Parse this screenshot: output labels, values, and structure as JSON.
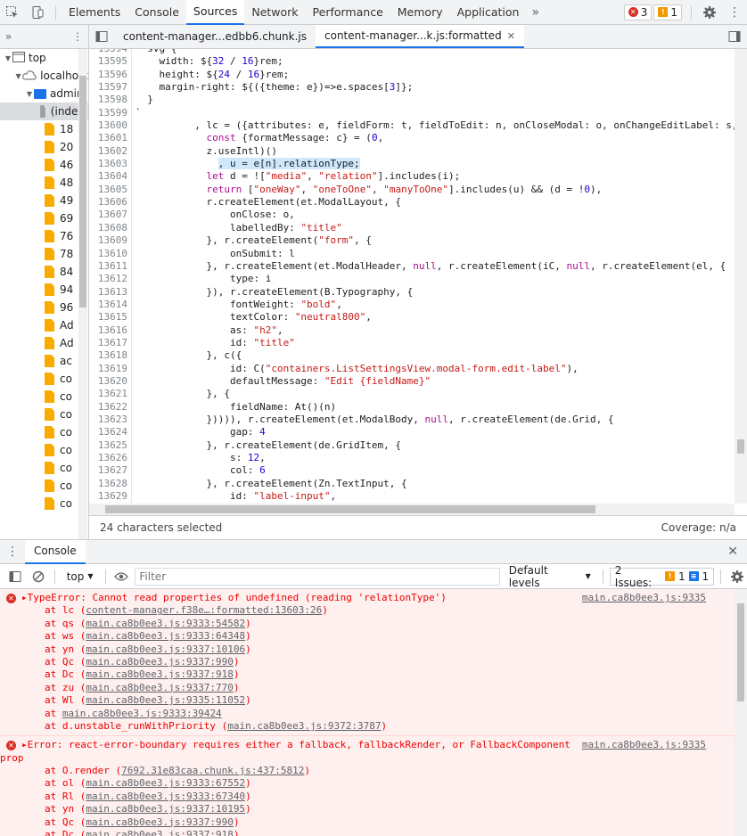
{
  "toolbar": {
    "tabs": [
      "Elements",
      "Console",
      "Sources",
      "Network",
      "Performance",
      "Memory",
      "Application"
    ],
    "active_tab": "Sources",
    "more_label": "»",
    "error_count": "3",
    "warning_count": "1"
  },
  "navigator": {
    "more_label": "»",
    "tree": [
      {
        "label": "top",
        "indent": 0,
        "type": "frame",
        "expanded": true
      },
      {
        "label": "localhost",
        "indent": 1,
        "type": "cloud",
        "expanded": true
      },
      {
        "label": "admin",
        "indent": 2,
        "type": "folder",
        "expanded": true
      },
      {
        "label": "(index)",
        "indent": 3,
        "type": "file-grey",
        "selected": true
      },
      {
        "label": "18",
        "indent": 3,
        "type": "file"
      },
      {
        "label": "20",
        "indent": 3,
        "type": "file"
      },
      {
        "label": "46",
        "indent": 3,
        "type": "file"
      },
      {
        "label": "48",
        "indent": 3,
        "type": "file"
      },
      {
        "label": "49",
        "indent": 3,
        "type": "file"
      },
      {
        "label": "69",
        "indent": 3,
        "type": "file"
      },
      {
        "label": "76",
        "indent": 3,
        "type": "file"
      },
      {
        "label": "78",
        "indent": 3,
        "type": "file"
      },
      {
        "label": "84",
        "indent": 3,
        "type": "file"
      },
      {
        "label": "94",
        "indent": 3,
        "type": "file"
      },
      {
        "label": "96",
        "indent": 3,
        "type": "file"
      },
      {
        "label": "Ad",
        "indent": 3,
        "type": "file"
      },
      {
        "label": "Ad",
        "indent": 3,
        "type": "file"
      },
      {
        "label": "ac",
        "indent": 3,
        "type": "file"
      },
      {
        "label": "co",
        "indent": 3,
        "type": "file"
      },
      {
        "label": "co",
        "indent": 3,
        "type": "file"
      },
      {
        "label": "co",
        "indent": 3,
        "type": "file"
      },
      {
        "label": "co",
        "indent": 3,
        "type": "file"
      },
      {
        "label": "co",
        "indent": 3,
        "type": "file"
      },
      {
        "label": "co",
        "indent": 3,
        "type": "file"
      },
      {
        "label": "co",
        "indent": 3,
        "type": "file"
      },
      {
        "label": "co",
        "indent": 3,
        "type": "file"
      }
    ]
  },
  "editor_tabs": [
    {
      "label": "content-manager...edbb6.chunk.js",
      "active": false
    },
    {
      "label": "content-manager...k.js:formatted",
      "active": true
    }
  ],
  "code": {
    "lines": [
      {
        "n": "13594",
        "html": "  svg {"
      },
      {
        "n": "13595",
        "html": "    width: ${<span class=\"nu\">32</span> / <span class=\"nu\">16</span>}rem;"
      },
      {
        "n": "13596",
        "html": "    height: ${<span class=\"nu\">24</span> / <span class=\"nu\">16</span>}rem;"
      },
      {
        "n": "13597",
        "html": "    margin-right: ${({theme: e})=>e.spaces[<span class=\"nu\">3</span>]};"
      },
      {
        "n": "13598",
        "html": "  }"
      },
      {
        "n": "13599",
        "html": "`"
      },
      {
        "n": "13600",
        "html": "          , lc = ({attributes: e, fieldForm: t, fieldToEdit: n, onCloseModal: o, onChangeEditLabel: s, onSubm"
      },
      {
        "n": "13601",
        "html": "            <span class=\"kw\">const</span> {formatMessage: c} = (<span class=\"nu\">0</span>,"
      },
      {
        "n": "13602",
        "html": "            z.useIntl)()"
      },
      {
        "n": "13603",
        "html": "              <span class=\"hl\">, u = e[n].relationType;</span>"
      },
      {
        "n": "13604",
        "html": "            <span class=\"kw\">let</span> d = ![<span class=\"st\">\"media\"</span>, <span class=\"st\">\"relation\"</span>].includes(i);"
      },
      {
        "n": "13605",
        "html": "            <span class=\"kw\">return</span> [<span class=\"st\">\"oneWay\"</span>, <span class=\"st\">\"oneToOne\"</span>, <span class=\"st\">\"manyToOne\"</span>].includes(u) &amp;&amp; (d = !<span class=\"nu\">0</span>),"
      },
      {
        "n": "13606",
        "html": "            r.createElement(et.ModalLayout, {"
      },
      {
        "n": "13607",
        "html": "                onClose: o,"
      },
      {
        "n": "13608",
        "html": "                labelledBy: <span class=\"st\">\"title\"</span>"
      },
      {
        "n": "13609",
        "html": "            }, r.createElement(<span class=\"st\">\"form\"</span>, {"
      },
      {
        "n": "13610",
        "html": "                onSubmit: l"
      },
      {
        "n": "13611",
        "html": "            }, r.createElement(et.ModalHeader, <span class=\"kw\">null</span>, r.createElement(iC, <span class=\"kw\">null</span>, r.createElement(el, {"
      },
      {
        "n": "13612",
        "html": "                type: i"
      },
      {
        "n": "13613",
        "html": "            }), r.createElement(B.Typography, {"
      },
      {
        "n": "13614",
        "html": "                fontWeight: <span class=\"st\">\"bold\"</span>,"
      },
      {
        "n": "13615",
        "html": "                textColor: <span class=\"st\">\"neutral800\"</span>,"
      },
      {
        "n": "13616",
        "html": "                as: <span class=\"st\">\"h2\"</span>,"
      },
      {
        "n": "13617",
        "html": "                id: <span class=\"st\">\"title\"</span>"
      },
      {
        "n": "13618",
        "html": "            }, c({"
      },
      {
        "n": "13619",
        "html": "                id: C(<span class=\"st\">\"containers.ListSettingsView.modal-form.edit-label\"</span>),"
      },
      {
        "n": "13620",
        "html": "                defaultMessage: <span class=\"st\">\"Edit {fieldName}\"</span>"
      },
      {
        "n": "13621",
        "html": "            }, {"
      },
      {
        "n": "13622",
        "html": "                fieldName: At()(n)"
      },
      {
        "n": "13623",
        "html": "            })))), r.createElement(et.ModalBody, <span class=\"kw\">null</span>, r.createElement(de.Grid, {"
      },
      {
        "n": "13624",
        "html": "                gap: <span class=\"nu\">4</span>"
      },
      {
        "n": "13625",
        "html": "            }, r.createElement(de.GridItem, {"
      },
      {
        "n": "13626",
        "html": "                s: <span class=\"nu\">12</span>,"
      },
      {
        "n": "13627",
        "html": "                col: <span class=\"nu\">6</span>"
      },
      {
        "n": "13628",
        "html": "            }, r.createElement(Zn.TextInput, {"
      },
      {
        "n": "13629",
        "html": "                id: <span class=\"st\">\"label-input\"</span>,"
      }
    ]
  },
  "status": {
    "selection": "24 characters selected",
    "coverage": "Coverage: n/a"
  },
  "drawer": {
    "tab": "Console",
    "context": "top",
    "filter_placeholder": "Filter",
    "levels": "Default levels",
    "issues_label": "2 Issues:",
    "issues_warn": "1",
    "issues_info": "1"
  },
  "messages": [
    {
      "source": "main.ca8b0ee3.js:9335",
      "lines": [
        {
          "text": "▸TypeError: Cannot read properties of undefined (reading 'relationType')",
          "trace": false
        },
        {
          "pre": "at lc (",
          "link": "content-manager.f38e…:formatted:13603:26",
          "post": ")",
          "trace": true
        },
        {
          "pre": "at qs (",
          "link": "main.ca8b0ee3.js:9333:54582",
          "post": ")",
          "trace": true
        },
        {
          "pre": "at ws (",
          "link": "main.ca8b0ee3.js:9333:64348",
          "post": ")",
          "trace": true
        },
        {
          "pre": "at yn (",
          "link": "main.ca8b0ee3.js:9337:10106",
          "post": ")",
          "trace": true
        },
        {
          "pre": "at Qc (",
          "link": "main.ca8b0ee3.js:9337:990",
          "post": ")",
          "trace": true
        },
        {
          "pre": "at Dc (",
          "link": "main.ca8b0ee3.js:9337:918",
          "post": ")",
          "trace": true
        },
        {
          "pre": "at zu (",
          "link": "main.ca8b0ee3.js:9337:770",
          "post": ")",
          "trace": true
        },
        {
          "pre": "at Wl (",
          "link": "main.ca8b0ee3.js:9335:11052",
          "post": ")",
          "trace": true
        },
        {
          "pre": "at ",
          "link": "main.ca8b0ee3.js:9333:39424",
          "post": "",
          "trace": true
        },
        {
          "pre": "at d.unstable_runWithPriority (",
          "link": "main.ca8b0ee3.js:9372:3787",
          "post": ")",
          "trace": true
        }
      ]
    },
    {
      "source": "main.ca8b0ee3.js:9335",
      "lines": [
        {
          "text": "▸Error: react-error-boundary requires either a fallback, fallbackRender, or FallbackComponent",
          "trace": false
        },
        {
          "text": "prop",
          "trace": false,
          "flush": true
        },
        {
          "pre": "at O.render (",
          "link": "7692.31e83caa.chunk.js:437:5812",
          "post": ")",
          "trace": true
        },
        {
          "pre": "at ol (",
          "link": "main.ca8b0ee3.js:9333:67552",
          "post": ")",
          "trace": true
        },
        {
          "pre": "at Rl (",
          "link": "main.ca8b0ee3.js:9333:67340",
          "post": ")",
          "trace": true
        },
        {
          "pre": "at yn (",
          "link": "main.ca8b0ee3.js:9337:10195",
          "post": ")",
          "trace": true
        },
        {
          "pre": "at Qc (",
          "link": "main.ca8b0ee3.js:9337:990",
          "post": ")",
          "trace": true
        },
        {
          "pre": "at Dc (",
          "link": "main.ca8b0ee3.js:9337:918",
          "post": ")",
          "trace": true
        }
      ]
    }
  ]
}
